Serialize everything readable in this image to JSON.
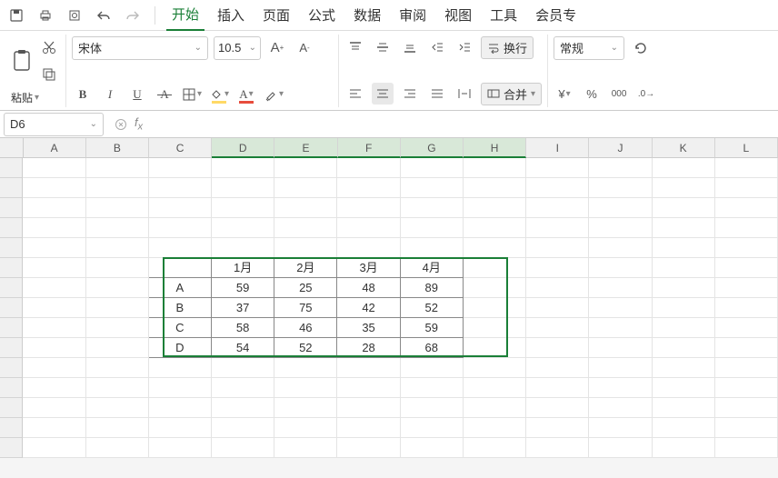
{
  "menubar": {
    "tabs": [
      "开始",
      "插入",
      "页面",
      "公式",
      "数据",
      "审阅",
      "视图",
      "工具",
      "会员专"
    ],
    "active_index": 0
  },
  "ribbon": {
    "paste_label": "粘贴",
    "font_name": "宋体",
    "font_size": "10.5",
    "wrap_label": "换行",
    "merge_label": "合并",
    "number_format": "常规"
  },
  "namebox": {
    "cell_ref": "D6",
    "formula": ""
  },
  "columns": [
    "A",
    "B",
    "C",
    "D",
    "E",
    "F",
    "G",
    "H",
    "I",
    "J",
    "K",
    "L"
  ],
  "selected_cols": [
    "D",
    "E",
    "F",
    "G",
    "H"
  ],
  "chart_data": {
    "type": "table",
    "title": "",
    "categories": [
      "1月",
      "2月",
      "3月",
      "4月"
    ],
    "series": [
      {
        "name": "A",
        "values": [
          59,
          25,
          48,
          89
        ]
      },
      {
        "name": "B",
        "values": [
          37,
          75,
          42,
          52
        ]
      },
      {
        "name": "C",
        "values": [
          58,
          46,
          35,
          59
        ]
      },
      {
        "name": "D",
        "values": [
          54,
          52,
          28,
          68
        ]
      }
    ],
    "top_left_cell": "C6",
    "range": "C6:H10"
  },
  "row_count": 15
}
